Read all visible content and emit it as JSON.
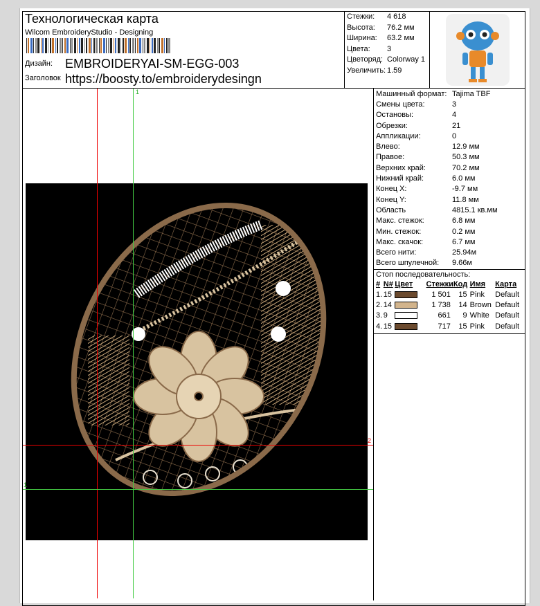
{
  "header": {
    "title": "Технологическая карта",
    "subtitle": "Wilcom EmbroideryStudio - Designing",
    "design_label": "Дизайн:",
    "design_value": "EMBROIDERYAI-SM-EGG-003",
    "heading_label": "Заголовок",
    "heading_value": "https://boosty.to/embroiderydesingn"
  },
  "stats": [
    {
      "k": "Стежки:",
      "v": "4 618"
    },
    {
      "k": "Высота:",
      "v": "76.2 мм"
    },
    {
      "k": "Ширина:",
      "v": "63.2 мм"
    },
    {
      "k": "Цвета:",
      "v": "3"
    },
    {
      "k": "Цветоряд:",
      "v": "Colorway 1"
    },
    {
      "k": "Увеличить:",
      "v": "1.59"
    }
  ],
  "info": [
    {
      "k": "Машинный формат:",
      "v": "Tajima TBF"
    },
    {
      "k": "Смены цвета:",
      "v": "3"
    },
    {
      "k": "Остановы:",
      "v": "4"
    },
    {
      "k": "Обрезки:",
      "v": "21"
    },
    {
      "k": "Аппликации:",
      "v": "0"
    },
    {
      "k": "Влево:",
      "v": "12.9 мм"
    },
    {
      "k": "Правое:",
      "v": "50.3 мм"
    },
    {
      "k": "Верхних край:",
      "v": "70.2 мм"
    },
    {
      "k": "Нижний край:",
      "v": "6.0 мм"
    },
    {
      "k": "Конец X:",
      "v": "-9.7 мм"
    },
    {
      "k": "Конец Y:",
      "v": "11.8 мм"
    },
    {
      "k": "Область",
      "v": "4815.1 кв.мм"
    },
    {
      "k": "Макс. стежок:",
      "v": "6.8 мм"
    },
    {
      "k": "Мин. стежок:",
      "v": "0.2 мм"
    },
    {
      "k": "Макс. скачок:",
      "v": "6.7 мм"
    },
    {
      "k": "Всего нити:",
      "v": "25.94м"
    },
    {
      "k": "Всего шпулечной:",
      "v": "9.66м"
    }
  ],
  "stop_sequence": {
    "title": "Стоп последовательность:",
    "headers": [
      "#",
      "N#",
      "Цвет",
      "Стежки",
      "Код",
      "Имя",
      "Карта"
    ],
    "rows": [
      {
        "n": "1.",
        "id": "15",
        "color": "#6b4a2e",
        "stitches": "1 501",
        "code": "15",
        "name": "Pink",
        "map": "Default"
      },
      {
        "n": "2.",
        "id": "14",
        "color": "#d2b48c",
        "stitches": "1 738",
        "code": "14",
        "name": "Brown",
        "map": "Default"
      },
      {
        "n": "3.",
        "id": "9",
        "color": "#ffffff",
        "stitches": "661",
        "code": "9",
        "name": "White",
        "map": "Default"
      },
      {
        "n": "4.",
        "id": "15",
        "color": "#6b4a2e",
        "stitches": "717",
        "code": "15",
        "name": "Pink",
        "map": "Default"
      }
    ]
  },
  "markers": {
    "top": "1",
    "right": "2",
    "left": "1"
  }
}
